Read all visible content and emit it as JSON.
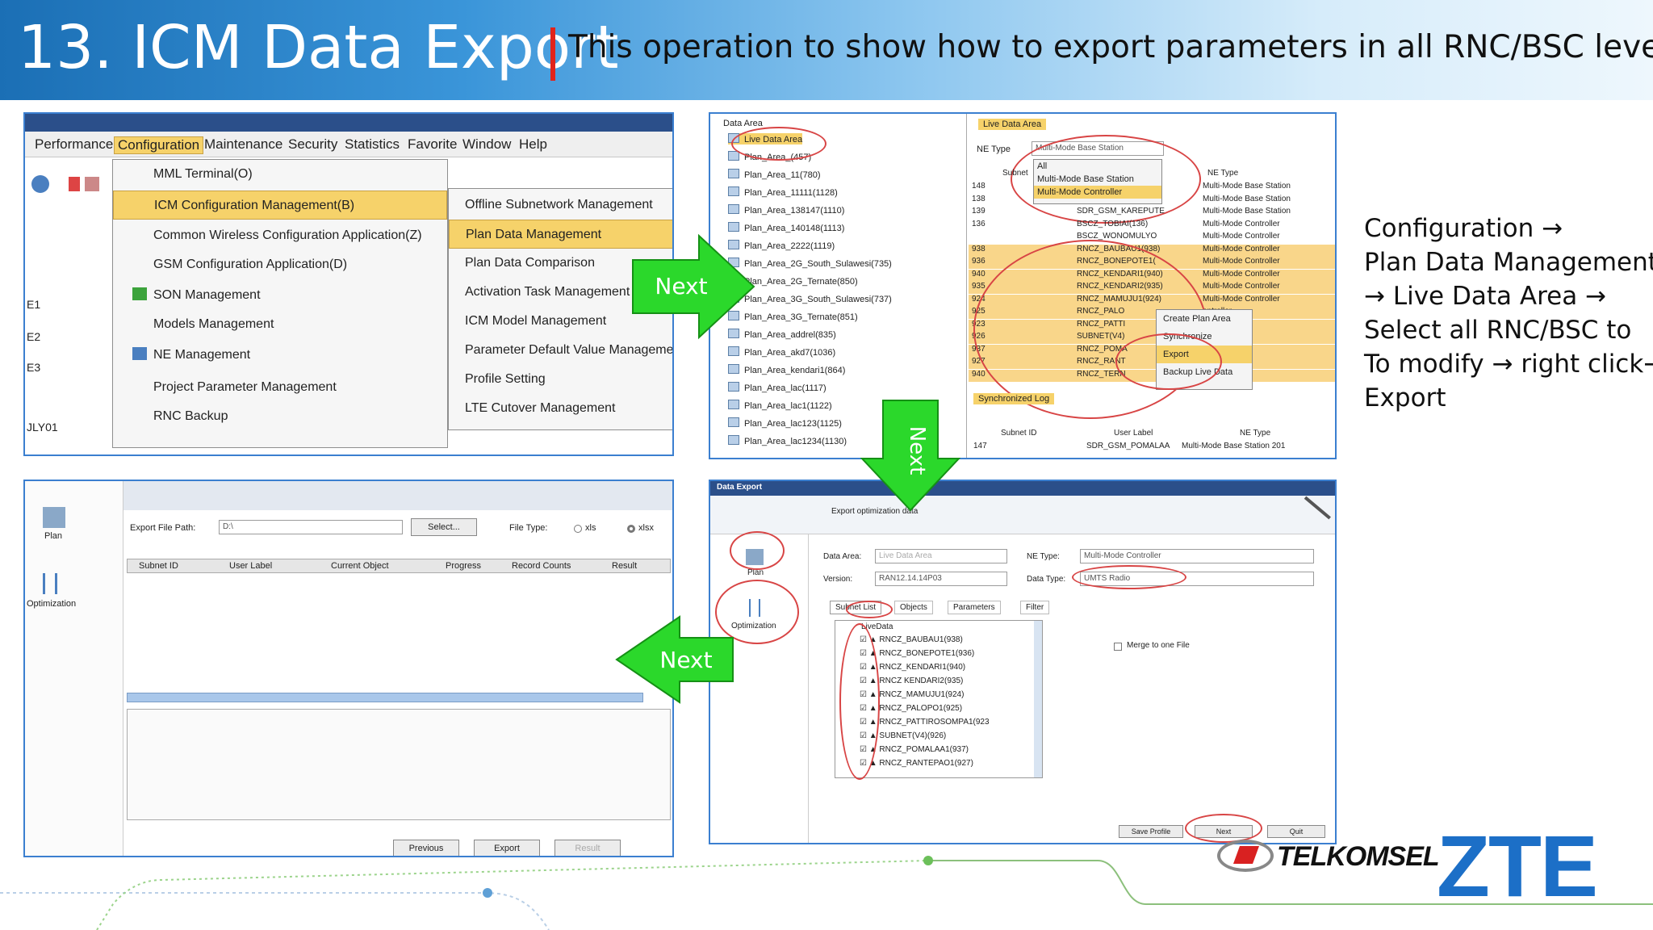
{
  "header": {
    "title": "13. ICM Data Export",
    "subtitle": "This operation to show how to export parameters in all RNC/BSC level"
  },
  "panel1": {
    "menubar": [
      "Performance",
      "Configuration",
      "Maintenance",
      "Security",
      "Statistics",
      "Favorite",
      "Window",
      "Help"
    ],
    "menu": [
      "MML Terminal(O)",
      "ICM Configuration Management(B)",
      "Common Wireless Configuration Application(Z)",
      "GSM Configuration Application(D)",
      "SON Management",
      "Models Management",
      "NE Management",
      "Project Parameter Management",
      "RNC Backup"
    ],
    "submenu": [
      "Offline Subnetwork Management",
      "Plan Data Management",
      "Plan Data Comparison",
      "Activation Task Management",
      "ICM Model Management",
      "Parameter Default Value Management",
      "Profile Setting",
      "LTE Cutover Management"
    ],
    "left_labels": [
      "E1",
      "E2",
      "E3",
      "JLY01"
    ]
  },
  "panel2": {
    "tree_title": "Data Area",
    "tree": [
      "Live Data Area",
      "Plan_Area_(457)",
      "Plan_Area_11(780)",
      "Plan_Area_11111(1128)",
      "Plan_Area_138147(1110)",
      "Plan_Area_140148(1113)",
      "Plan_Area_2222(1119)",
      "Plan_Area_2G_South_Sulawesi(735)",
      "Plan_Area_2G_Ternate(850)",
      "Plan_Area_3G_South_Sulawesi(737)",
      "Plan_Area_3G_Ternate(851)",
      "Plan_Area_addrel(835)",
      "Plan_Area_akd7(1036)",
      "Plan_Area_kendari1(864)",
      "Plan_Area_lac(1117)",
      "Plan_Area_lac1(1122)",
      "Plan_Area_lac123(1125)",
      "Plan_Area_lac1234(1130)"
    ],
    "live_title": "Live Data Area",
    "ne_type_label": "NE Type",
    "ne_type_value": "Multi-Mode Base Station",
    "dropdown": [
      "All",
      "Multi-Mode Base Station",
      "Multi-Mode Controller"
    ],
    "col_subnet": "Subnet",
    "col_netype": "NE Type",
    "rows": [
      {
        "id": "148",
        "label": "",
        "type": "Multi-Mode Base Station"
      },
      {
        "id": "138",
        "label": "",
        "type": "Multi-Mode Base Station"
      },
      {
        "id": "139",
        "label": "SDR_GSM_KAREPUTE",
        "type": "Multi-Mode Base Station"
      },
      {
        "id": "136",
        "label": "BSCZ_TOBIAI(136)",
        "type": "Multi-Mode Controller"
      },
      {
        "id": "",
        "label": "BSCZ_WONOMULYO",
        "type": "Multi-Mode Controller"
      },
      {
        "id": "938",
        "label": "RNCZ_BAUBAU1(938)",
        "type": "Multi-Mode Controller"
      },
      {
        "id": "936",
        "label": "RNCZ_BONEPOTE1(",
        "type": "Multi-Mode Controller"
      },
      {
        "id": "940",
        "label": "RNCZ_KENDARI1(940)",
        "type": "Multi-Mode Controller"
      },
      {
        "id": "935",
        "label": "RNCZ_KENDARI2(935)",
        "type": "Multi-Mode Controller"
      },
      {
        "id": "924",
        "label": "RNCZ_MAMUJU1(924)",
        "type": "Multi-Mode Controller"
      },
      {
        "id": "925",
        "label": "RNCZ_PALO",
        "type": "ontroller"
      },
      {
        "id": "923",
        "label": "RNCZ_PATTI",
        "type": "ontroller"
      },
      {
        "id": "926",
        "label": "SUBNET(V4)",
        "type": "ontroller"
      },
      {
        "id": "937",
        "label": "RNCZ_POMA",
        "type": "ontroller"
      },
      {
        "id": "927",
        "label": "RNCZ_RANT",
        "type": "ontroller"
      },
      {
        "id": "940",
        "label": "RNCZ_TERN",
        "type": "ontroller"
      }
    ],
    "context": [
      "Create Plan Area",
      "Synchronize",
      "Export",
      "Backup Live Data"
    ],
    "sync_title": "Synchronized Log",
    "sync_cols": [
      "Subnet ID",
      "User Label",
      "NE Type"
    ],
    "sync_row": [
      "147",
      "SDR_GSM_POMALAA",
      "Multi-Mode Base Station 201"
    ]
  },
  "panel3": {
    "side": [
      "Plan",
      "Optimization"
    ],
    "path_label": "Export File Path:",
    "path_value": "D:\\",
    "select_btn": "Select...",
    "filetype_label": "File Type:",
    "opt_xls": "xls",
    "opt_xlsx": "xlsx",
    "cols": [
      "Subnet ID",
      "User Label",
      "Current Object",
      "Progress",
      "Record Counts",
      "Result"
    ],
    "btns": [
      "Previous",
      "Export",
      "Result"
    ]
  },
  "panel4": {
    "title": "Data Export",
    "subtitle": "Export optimization data",
    "side": [
      "Plan",
      "Optimization"
    ],
    "data_area_label": "Data Area:",
    "data_area_value": "Live Data Area",
    "ne_type_label": "NE Type:",
    "ne_type_value": "Multi-Mode Controller",
    "version_label": "Version:",
    "version_value": "RAN12.14.14P03",
    "data_type_label": "Data Type:",
    "data_type_value": "UMTS Radio",
    "tabs": [
      "Subnet List",
      "Objects",
      "Parameters",
      "Filter"
    ],
    "root": "LiveData",
    "items": [
      "RNCZ_BAUBAU1(938)",
      "RNCZ_BONEPOTE1(936)",
      "RNCZ_KENDARI1(940)",
      "RNCZ KENDARI2(935)",
      "RNCZ_MAMUJU1(924)",
      "RNCZ_PALOPO1(925)",
      "RNCZ_PATTIROSOMPA1(923",
      "SUBNET(V4)(926)",
      "RNCZ_POMALAA1(937)",
      "RNCZ_RANTEPAO1(927)"
    ],
    "merge": "Merge to one File",
    "btns": [
      "Save Profile",
      "Next",
      "Quit"
    ]
  },
  "arrows": {
    "a1": "Next",
    "a2": "Next",
    "a3": "Next",
    "color": "#2bd82b"
  },
  "instructions": [
    "Configuration →",
    "Plan Data Management",
    "→ Live Data Area →",
    "Select all RNC/BSC to",
    "To modify → right click→",
    "Export"
  ],
  "logos": {
    "telkomsel": "TELKOMSEL",
    "zte": "ZTE"
  }
}
